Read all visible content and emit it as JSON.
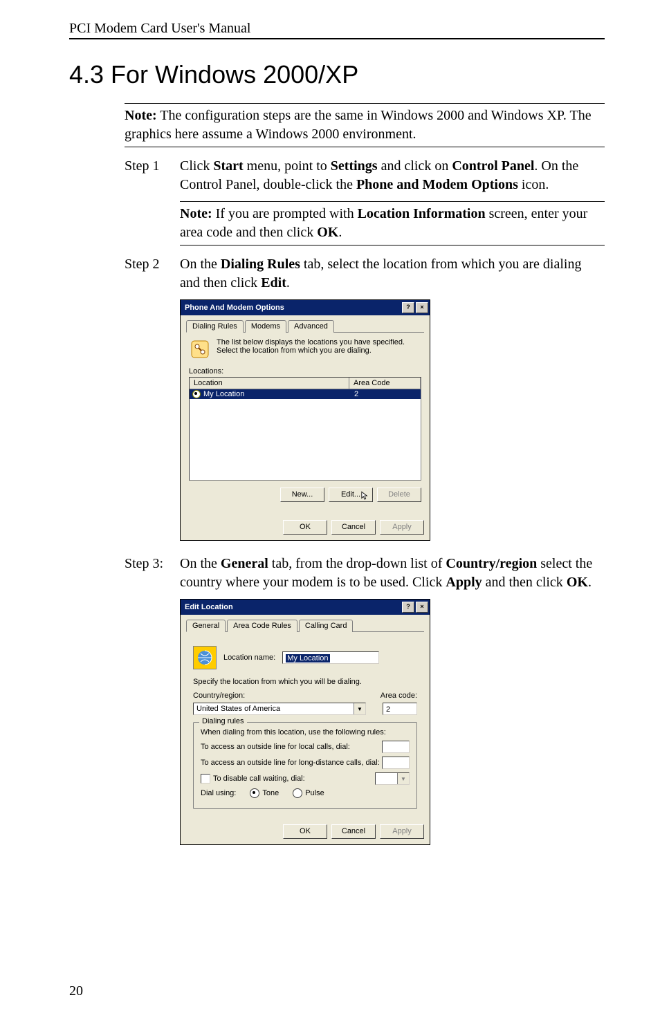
{
  "header": "PCI Modem Card User's Manual",
  "section_title": "4.3 For Windows 2000/XP",
  "note1": {
    "label": "Note:",
    "text": " The configuration steps are the same in Windows 2000 and Windows XP. The graphics here assume a Windows 2000 environment."
  },
  "step1": {
    "label": "Step 1",
    "pre": "Click ",
    "b1": "Start",
    "mid1": " menu, point to ",
    "b2": "Settings",
    "mid2": " and click on ",
    "b3": "Control Panel",
    "mid3": ". On the Control Panel, double-click the ",
    "b4": "Phone and Modem Options",
    "post": " icon."
  },
  "inner_note": {
    "label": "Note:",
    "pre": " If you are prompted with ",
    "b1": "Location Information",
    "mid": " screen, enter your area code and then click ",
    "b2": "OK",
    "post": "."
  },
  "step2": {
    "label": "Step 2",
    "pre": "On the ",
    "b1": "Dialing Rules",
    "mid": " tab, select the location from which you are dialing and then click ",
    "b2": "Edit",
    "post": "."
  },
  "dlg1": {
    "title": "Phone And Modem Options",
    "help_btn": "?",
    "close_btn": "×",
    "tabs": [
      "Dialing Rules",
      "Modems",
      "Advanced"
    ],
    "info_text": "The list below displays the locations you have specified. Select the location from which you are dialing.",
    "locations_label": "Locations:",
    "col_location": "Location",
    "col_area": "Area Code",
    "row_location": "My Location",
    "row_area": "2",
    "btn_new": "New...",
    "btn_edit": "Edit...",
    "btn_delete": "Delete",
    "btn_ok": "OK",
    "btn_cancel": "Cancel",
    "btn_apply": "Apply"
  },
  "step3": {
    "label": "Step 3:",
    "pre": "On the ",
    "b1": "General",
    "mid1": " tab, from the drop-down list of ",
    "b2": "Country/region",
    "mid2": " select the country where your modem is to be used. Click ",
    "b3": "Apply",
    "mid3": " and then click ",
    "b4": "OK",
    "post": "."
  },
  "dlg2": {
    "title": "Edit Location",
    "help_btn": "?",
    "close_btn": "×",
    "tabs": [
      "General",
      "Area Code Rules",
      "Calling Card"
    ],
    "loc_name_label": "Location name:",
    "loc_name_value": "My Location",
    "specify_text": "Specify the location from which you will be dialing.",
    "country_label": "Country/region:",
    "area_code_label": "Area code:",
    "country_value": "United States of America",
    "area_code_value": "2",
    "group_title": "Dialing rules",
    "rule_intro": "When dialing from this location, use the following rules:",
    "rule_local": "To access an outside line for local calls, dial:",
    "rule_long": "To access an outside line for long-distance calls, dial:",
    "rule_disable_cw": "To disable call waiting, dial:",
    "dial_using": "Dial using:",
    "tone": "Tone",
    "pulse": "Pulse",
    "btn_ok": "OK",
    "btn_cancel": "Cancel",
    "btn_apply": "Apply"
  },
  "page_number": "20"
}
